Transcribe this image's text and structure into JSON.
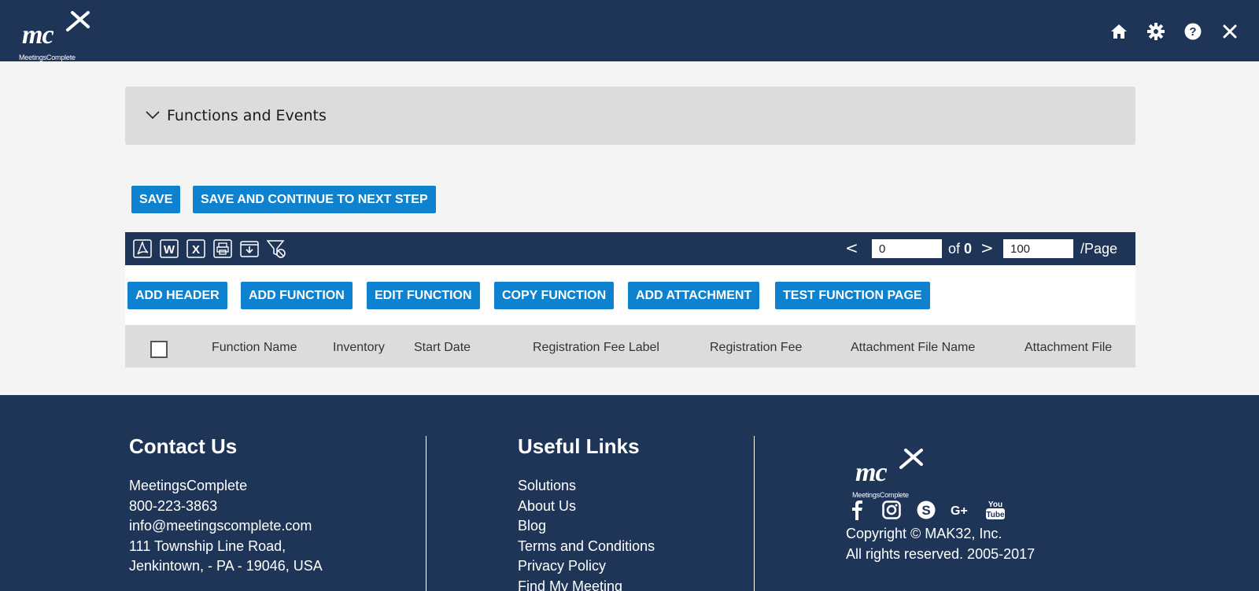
{
  "header": {
    "logo": {
      "mark": "mc",
      "brand": "MeetingsComplete"
    },
    "icons": [
      "home-icon",
      "gear-icon",
      "help-icon",
      "close-icon"
    ]
  },
  "panel": {
    "title": "Functions and Events"
  },
  "actions": {
    "save": "SAVE",
    "save_continue": "SAVE AND CONTINUE TO NEXT STEP"
  },
  "toolbar": {
    "export_icons": [
      "pdf-icon",
      "word-icon",
      "excel-icon",
      "print-icon",
      "download-icon",
      "clear-filter-icon"
    ],
    "pager": {
      "page": "0",
      "of_label": "of",
      "total": "0",
      "per_page": "100",
      "per_page_label": "/Page"
    }
  },
  "grid_buttons": [
    "ADD HEADER",
    "ADD FUNCTION",
    "EDIT FUNCTION",
    "COPY FUNCTION",
    "ADD ATTACHMENT",
    "TEST FUNCTION PAGE"
  ],
  "table": {
    "columns": [
      "Function Name",
      "Inventory",
      "Start Date",
      "Registration Fee Label",
      "Registration Fee",
      "Attachment File Name",
      "Attachment File"
    ]
  },
  "footer": {
    "contact": {
      "heading": "Contact Us",
      "lines": [
        "MeetingsComplete",
        "800-223-3863",
        "info@meetingscomplete.com",
        "111 Township Line Road,",
        "Jenkintown, - PA - 19046, USA"
      ]
    },
    "links": {
      "heading": "Useful Links",
      "items": [
        "Solutions",
        "About Us",
        "Blog",
        "Terms and Conditions",
        "Privacy Policy",
        "Find My Meeting"
      ]
    },
    "social": [
      "facebook-icon",
      "instagram-icon",
      "skype-icon",
      "google-plus-icon",
      "youtube-icon"
    ],
    "copyright": [
      "Copyright © MAK32, Inc.",
      "All rights reserved. 2005-2017"
    ]
  },
  "colors": {
    "navy": "#1f3557",
    "button_blue": "#0f82cf",
    "panel_gray": "#dcdcdc"
  }
}
